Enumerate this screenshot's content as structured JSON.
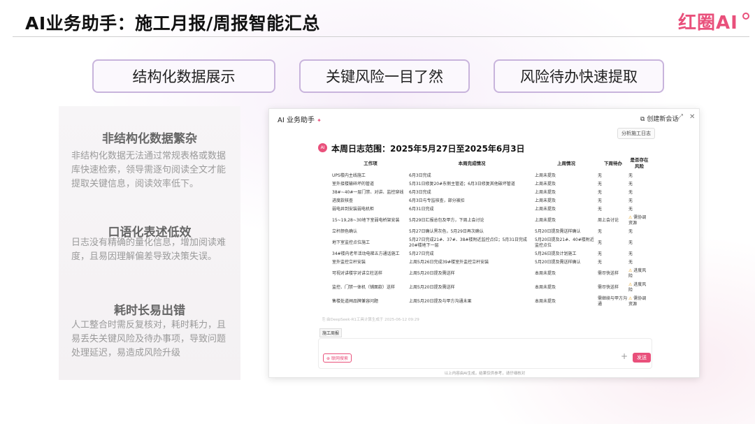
{
  "slide": {
    "title": "AI业务助手：施工月报/周报智能汇总",
    "brand": "红圈AI",
    "features": [
      "结构化数据展示",
      "关键风险一目了然",
      "风险待办快速提取"
    ]
  },
  "left_panel": [
    {
      "heading": "非结构化数据繁杂",
      "body": "非结构化数据无法通过常规表格或数据库快速检索，领导需逐句阅读全文才能提取关键信息，阅读效率低下。"
    },
    {
      "heading": "口语化表述低效",
      "body": "日志没有精确的量化信息，增加阅读难度，且易因理解偏差导致决策失误。"
    },
    {
      "heading": "耗时长易出错",
      "body": "人工整合时需反复核对，耗时耗力，且易丢失关键风险及待办事项，导致问题处理延迟，易造成风险升级"
    }
  ],
  "window": {
    "title": "AI 业务助手",
    "new_chat": "创建新会话",
    "analyze_button": "分析施工日志",
    "avatar": "AI",
    "report_heading": "本周日志范围：2025年5月27日至2025年6月3日",
    "table": {
      "headers": [
        "工作项",
        "本周完成情况",
        "上周情况",
        "下周待办",
        "是否存在风险"
      ],
      "rows": [
        {
          "item": "UPS楼内主线施工",
          "done": "6月3日完成",
          "last": "上周未提及",
          "next": "无",
          "risk": "无",
          "warn": false
        },
        {
          "item": "室外接楼输碎坏的管道",
          "done": "5月31日修复20#东侧主管道；6月3日修复其他破坏管道",
          "last": "上周未提及",
          "next": "无",
          "risk": "无",
          "warn": false
        },
        {
          "item": "38#~40#一层门禁、对讲、监控穿线",
          "done": "6月3日完成",
          "last": "上周未提及",
          "next": "无",
          "risk": "无",
          "warn": false
        },
        {
          "item": "进度款核查",
          "done": "6月3日与专监核查，部分被扣",
          "last": "上周未提及",
          "next": "无",
          "risk": "无",
          "warn": false
        },
        {
          "item": "弱电井到安装弱电机柜",
          "done": "6月31日完成",
          "last": "上周未提及",
          "next": "无",
          "risk": "无",
          "warn": false
        },
        {
          "item": "15~19,28~30地下室弱电桥架安装",
          "done": "5月29日汇报总包及甲方，下周上会讨论",
          "last": "上周未提及",
          "next": "周上会讨论",
          "risk": "需协调资源",
          "warn": true
        },
        {
          "item": "立杆颜色确认",
          "done": "5月27日确认黑灰色，5月29日再次确认",
          "last": "5月20日提及需送样确认",
          "next": "无",
          "risk": "无",
          "warn": false
        },
        {
          "item": "地下室监控点位施工",
          "done": "5月27日完成21#、37#、38#楼附近监控点位；5月31日完成20#楼地下一层",
          "last": "5月20日提及21#、40#楼附近监控点位",
          "next": "无",
          "risk": "无",
          "warn": false
        },
        {
          "item": "34#楼内老年活动电梯五方通话施工",
          "done": "5月27日完成",
          "last": "5月26日提及计划施工",
          "next": "无",
          "risk": "无",
          "warn": false
        },
        {
          "item": "室外监控立杆安装",
          "done": "上周5月26日完成39#楼室外监控立杆安装",
          "last": "5月20日提及需送样确认",
          "next": "无",
          "risk": "无",
          "warn": false
        },
        {
          "item": "可视对讲楼宇对讲立柱送样",
          "done": "上周5月20日提及需送样",
          "last": "本周未提及",
          "next": "需尽快送样",
          "risk": "进度风险",
          "warn": true
        },
        {
          "item": "监控、门禁一体机（铺面款）送样",
          "done": "上周5月20日提及需送样",
          "last": "本周未提及",
          "next": "需尽快送样",
          "risk": "进度风险",
          "warn": true
        },
        {
          "item": "售楼处道闸品牌兼容问题",
          "done": "上周5月20日提及与甲方沟通未果",
          "last": "本周未提及",
          "next": "需继续与甲方沟通",
          "risk": "需协调资源",
          "warn": true
        }
      ]
    },
    "gen_note": "由DeepSeek-R1工具计算生成于 2025-06-12 09:29",
    "tag": "施工周报",
    "web_search": "联网搜索",
    "send": "发送",
    "disclaimer": "以上内容由AI生成，结果仅供参考，请仔细核对"
  },
  "colors": {
    "accent": "#e9507b",
    "pill_border": "#c8b4dc",
    "warn": "#e8a317"
  }
}
